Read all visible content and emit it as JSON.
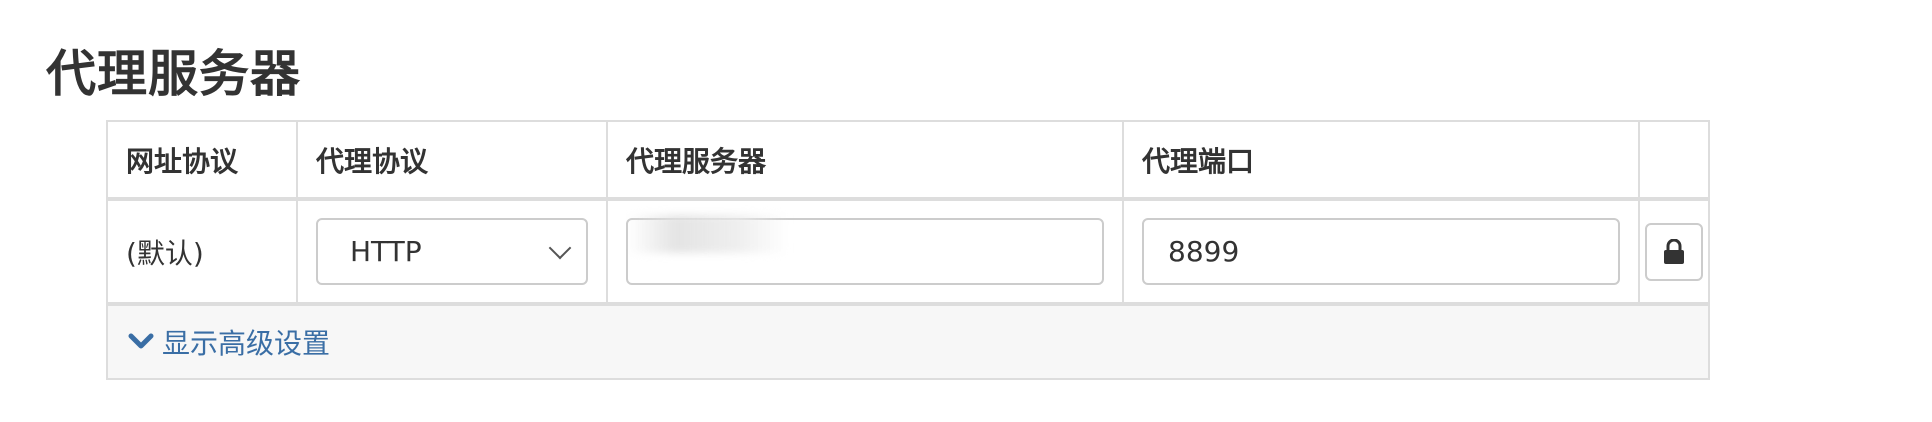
{
  "page": {
    "title": "代理服务器"
  },
  "table": {
    "headers": [
      "网址协议",
      "代理协议",
      "代理服务器",
      "代理端口",
      ""
    ],
    "rows": [
      {
        "url_protocol": "(默认)",
        "proxy_protocol": "HTTP",
        "proxy_server": "",
        "proxy_port": "8899",
        "lock_icon": "lock-icon"
      }
    ]
  },
  "footer": {
    "advanced_label": "显示高级设置",
    "advanced_icon": "chevron-down-icon"
  },
  "colors": {
    "link": "#3a6ea5",
    "border": "#dddddd",
    "footer_bg": "#f7f7f7"
  }
}
